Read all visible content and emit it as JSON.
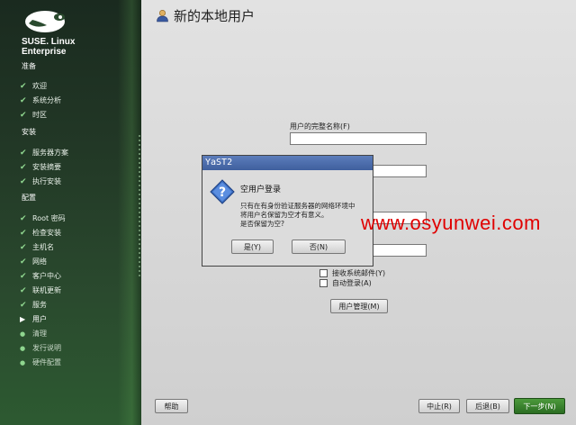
{
  "sidebar": {
    "brand_line1": "SUSE. Linux",
    "brand_line2": "Enterprise",
    "sections": [
      {
        "title": "准备",
        "items": [
          {
            "label": "欢迎",
            "state": "done"
          },
          {
            "label": "系统分析",
            "state": "done"
          },
          {
            "label": "时区",
            "state": "done"
          }
        ]
      },
      {
        "title": "安装",
        "items": [
          {
            "label": "服务器方案",
            "state": "done"
          },
          {
            "label": "安装摘要",
            "state": "done"
          },
          {
            "label": "执行安装",
            "state": "done"
          }
        ]
      },
      {
        "title": "配置",
        "items": [
          {
            "label": "Root 密码",
            "state": "done"
          },
          {
            "label": "检查安装",
            "state": "done"
          },
          {
            "label": "主机名",
            "state": "done"
          },
          {
            "label": "网络",
            "state": "done"
          },
          {
            "label": "客户中心",
            "state": "done"
          },
          {
            "label": "联机更新",
            "state": "done"
          },
          {
            "label": "服务",
            "state": "done"
          },
          {
            "label": "用户",
            "state": "current"
          },
          {
            "label": "清理",
            "state": "pending"
          },
          {
            "label": "发行说明",
            "state": "pending"
          },
          {
            "label": "硬件配置",
            "state": "pending"
          }
        ]
      }
    ],
    "icons": {
      "done": "checkmark-icon",
      "current": "arrow-right-icon",
      "pending": "bullet-icon"
    }
  },
  "content": {
    "page_title": "新的本地用户",
    "full_name_label": "用户的完整名称(F)",
    "full_name_value": "",
    "checkbox_receive_mail": "接收系统邮件(Y)",
    "checkbox_auto_login": "自动登录(A)",
    "user_management_button": "用户管理(M)"
  },
  "dialog": {
    "window_title": "YaST2",
    "heading": "空用户登录",
    "message_lines": [
      "只有在有身份验证服务器的网络环境中",
      "将用户名保留为空才有意义。",
      "是否保留为空?"
    ],
    "yes_button": "是(Y)",
    "no_button": "否(N)"
  },
  "footer": {
    "help_button": "帮助",
    "abort_button": "中止(R)",
    "back_button": "后退(B)",
    "next_button": "下一步(N)"
  },
  "watermark": "www.osyunwei.com",
  "colors": {
    "accent_green": "#2b6d22",
    "titlebar_blue": "#4a6aa8",
    "watermark_red": "#e00000"
  }
}
